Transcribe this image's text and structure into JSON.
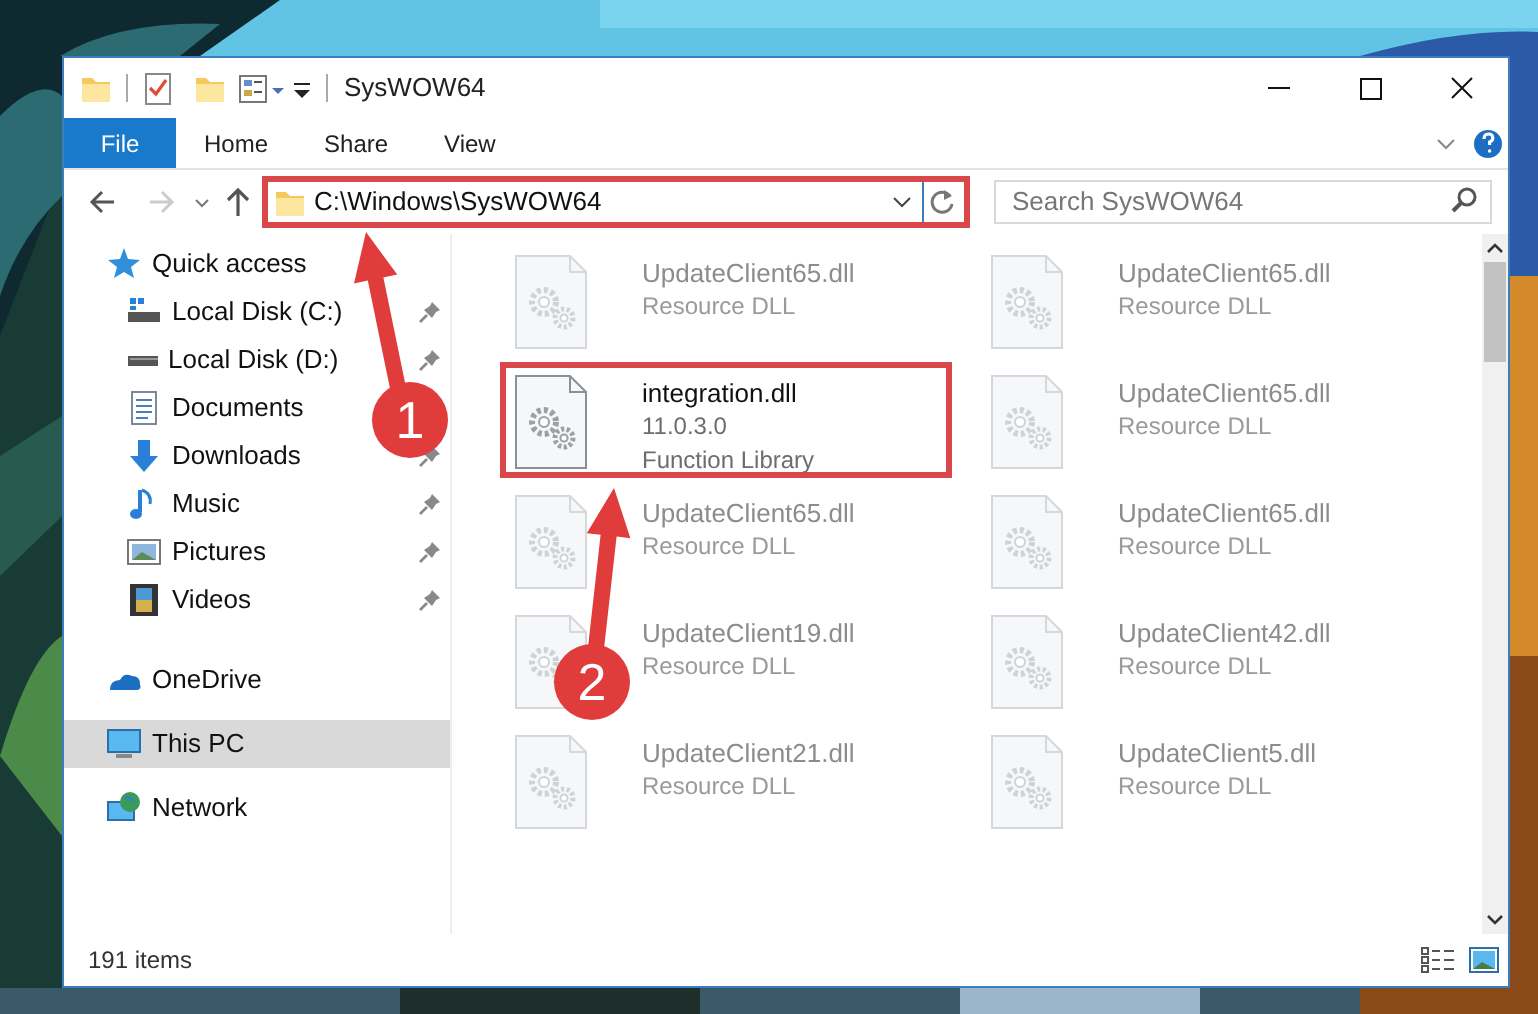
{
  "window": {
    "title": "SysWOW64"
  },
  "ribbon_tabs": [
    {
      "label": "File",
      "kind": "file"
    },
    {
      "label": "Home",
      "kind": "tab"
    },
    {
      "label": "Share",
      "kind": "tab"
    },
    {
      "label": "View",
      "kind": "tab"
    }
  ],
  "address_bar": {
    "path": "C:\\Windows\\SysWOW64",
    "highlighted": true
  },
  "search": {
    "placeholder": "Search SysWOW64"
  },
  "navigation": [
    {
      "label": "Quick access",
      "selected": false,
      "children": [
        {
          "label": "Local Disk (C:)",
          "pinned": true,
          "selected": false
        },
        {
          "label": "Local Disk (D:)",
          "pinned": true,
          "selected": false
        },
        {
          "label": "Documents",
          "selected": false
        },
        {
          "label": "Downloads",
          "pinned": true,
          "selected": false
        },
        {
          "label": "Music",
          "pinned": true,
          "selected": false
        },
        {
          "label": "Pictures",
          "pinned": true,
          "selected": false
        },
        {
          "label": "Videos",
          "pinned": true,
          "selected": false
        }
      ]
    },
    {
      "label": "OneDrive",
      "selected": false
    },
    {
      "label": "This PC",
      "selected": true
    },
    {
      "label": "Network",
      "selected": false
    }
  ],
  "files": [
    {
      "name": "UpdateClient65.dll",
      "lines": [
        "Resource DLL"
      ],
      "dimmed": true,
      "highlighted": false
    },
    {
      "name": "UpdateClient65.dll",
      "lines": [
        "Resource DLL"
      ],
      "dimmed": true,
      "highlighted": false
    },
    {
      "name": "integration.dll",
      "lines": [
        "11.0.3.0",
        "Function Library"
      ],
      "dimmed": false,
      "highlighted": true
    },
    {
      "name": "UpdateClient65.dll",
      "lines": [
        "Resource DLL"
      ],
      "dimmed": true,
      "highlighted": false
    },
    {
      "name": "UpdateClient65.dll",
      "lines": [
        "Resource DLL"
      ],
      "dimmed": true,
      "highlighted": false
    },
    {
      "name": "UpdateClient65.dll",
      "lines": [
        "Resource DLL"
      ],
      "dimmed": true,
      "highlighted": false
    },
    {
      "name": "UpdateClient19.dll",
      "lines": [
        "Resource DLL"
      ],
      "dimmed": true,
      "highlighted": false
    },
    {
      "name": "UpdateClient42.dll",
      "lines": [
        "Resource DLL"
      ],
      "dimmed": true,
      "highlighted": false
    },
    {
      "name": "UpdateClient21.dll",
      "lines": [
        "Resource DLL"
      ],
      "dimmed": true,
      "highlighted": false
    },
    {
      "name": "UpdateClient5.dll",
      "lines": [
        "Resource DLL"
      ],
      "dimmed": true,
      "highlighted": false
    }
  ],
  "status_bar": {
    "item_count": "191 items"
  },
  "annotations": [
    {
      "label": "1"
    },
    {
      "label": "2"
    }
  ]
}
